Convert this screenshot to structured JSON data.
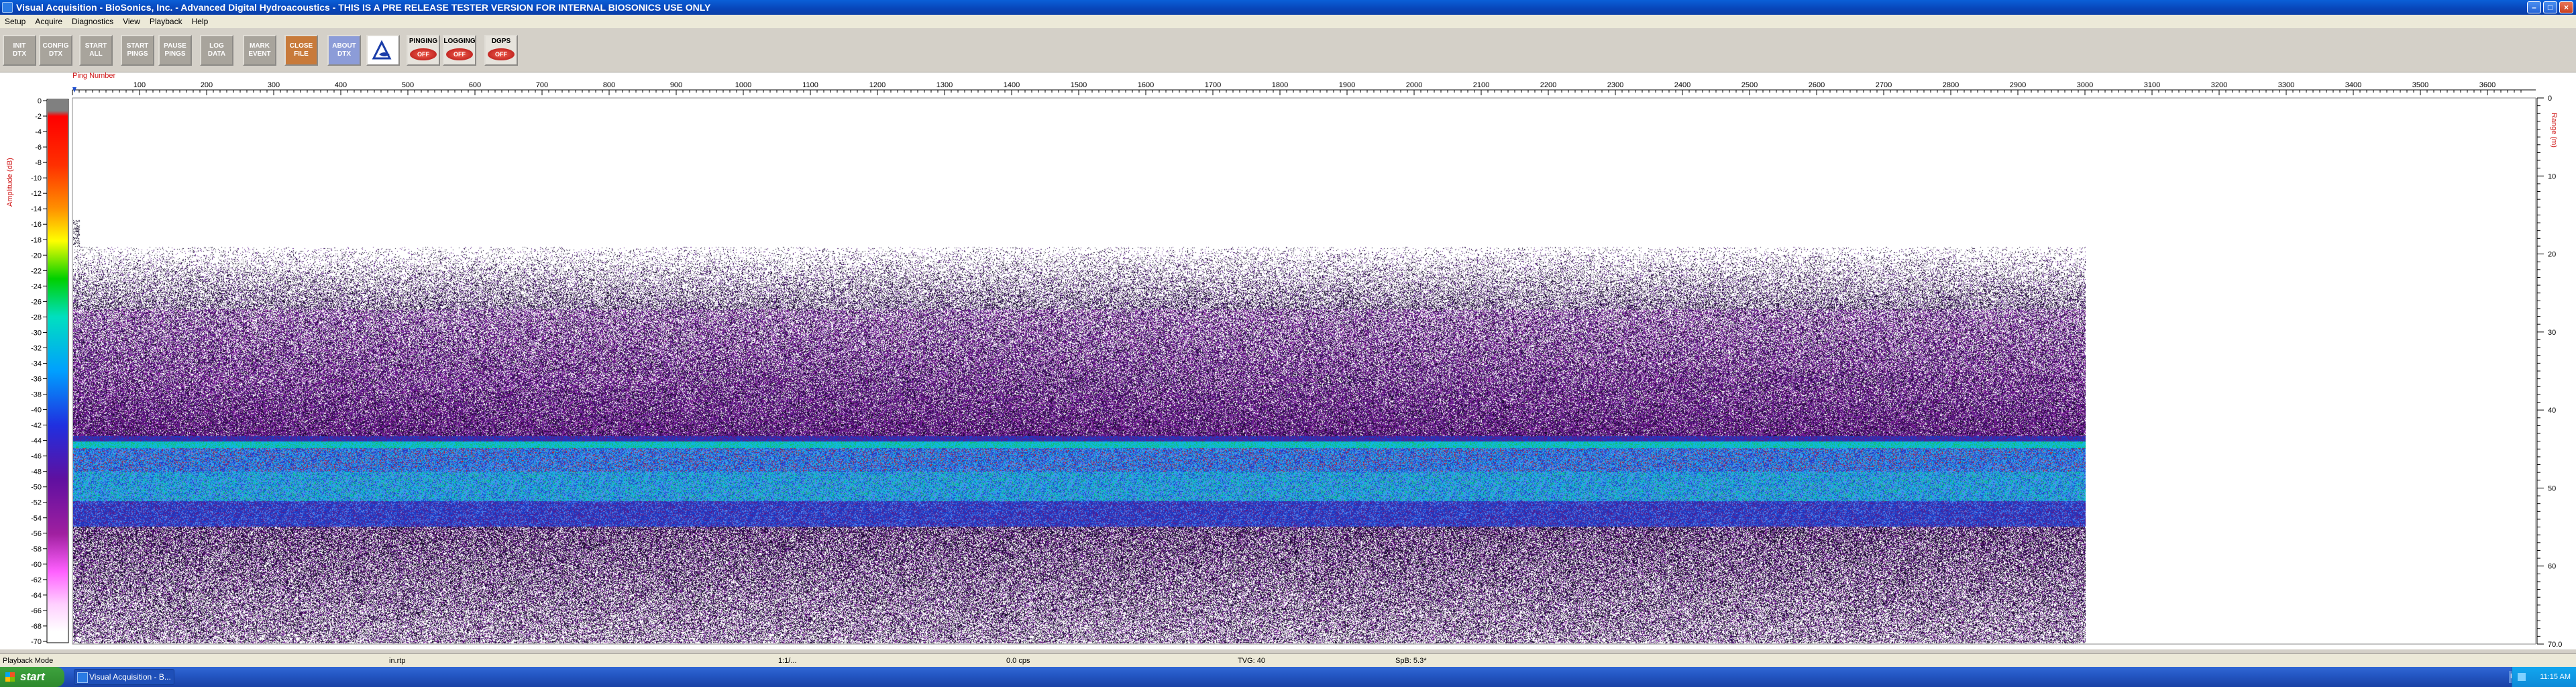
{
  "window": {
    "title": "Visual Acquisition  -  BioSonics, Inc.  -  Advanced Digital Hydroacoustics  -  THIS IS A PRE RELEASE TESTER VERSION FOR INTERNAL BIOSONICS USE ONLY"
  },
  "menu": [
    "Setup",
    "Acquire",
    "Diagnostics",
    "View",
    "Playback",
    "Help"
  ],
  "toolbar": {
    "buttons": [
      {
        "label": "INIT\nDTX",
        "style": "gray"
      },
      {
        "label": "CONFIG\nDTX",
        "style": "gray"
      },
      {
        "label": "START\nALL",
        "style": "gray"
      },
      {
        "label": "START\nPINGS",
        "style": "gray"
      },
      {
        "label": "PAUSE\nPINGS",
        "style": "gray"
      },
      {
        "label": "LOG\nDATA",
        "style": "gray"
      },
      {
        "label": "MARK\nEVENT",
        "style": "gray"
      },
      {
        "label": "CLOSE\nFILE",
        "style": "orange"
      },
      {
        "label": "ABOUT\nDTX",
        "style": "blue"
      }
    ],
    "indicators": [
      {
        "label": "PINGING",
        "state": "OFF"
      },
      {
        "label": "LOGGING",
        "state": "OFF"
      },
      {
        "label": "DGPS",
        "state": "OFF"
      }
    ]
  },
  "echogram": {
    "x_axis_title": "Ping Number",
    "x_ticks": [
      "100",
      "200",
      "300",
      "400",
      "500",
      "600",
      "700",
      "800",
      "900",
      "1000",
      "1100",
      "1200",
      "1300",
      "1400",
      "1500",
      "1600",
      "1700",
      "1800",
      "1900",
      "2000",
      "2100",
      "2200",
      "2300",
      "2400",
      "2500",
      "2600",
      "2700",
      "2800",
      "2900",
      "3000",
      "3100",
      "3200",
      "3300",
      "3400",
      "3500",
      "3600"
    ],
    "amplitude_axis_title": "Amplitude (dB)",
    "amplitude_ticks": [
      "0",
      "-2",
      "-4",
      "-6",
      "-8",
      "-10",
      "-12",
      "-14",
      "-16",
      "-18",
      "-20",
      "-22",
      "-24",
      "-26",
      "-28",
      "-30",
      "-32",
      "-34",
      "-36",
      "-38",
      "-40",
      "-42",
      "-44",
      "-46",
      "-48",
      "-50",
      "-52",
      "-54",
      "-56",
      "-58",
      "-60",
      "-62",
      "-64",
      "-66",
      "-68",
      "-70"
    ],
    "range_axis_title": "Range (m)",
    "range_ticks": [
      "0",
      "10",
      "20",
      "30",
      "40",
      "50",
      "60",
      "70.0"
    ],
    "data_pings": 3000,
    "max_range_m": 70.0,
    "noise_onset_m": 19,
    "dense_noise_m": 27,
    "bottom_band_top_m": 44,
    "bottom_band_bottom_m": 55,
    "colors": {
      "noise": "#5a1a8a",
      "bottom_cyan": "#10b8e0",
      "bottom_blue": "#1a3cc8",
      "bottom_red": "#d01818",
      "bottom_green": "#10c060"
    }
  },
  "status_bar": {
    "mode": "Playback Mode",
    "fields": [
      "in.rtp",
      "1:1/...",
      "0.0 cps",
      "TVG: 40",
      "SpB: 5.3*"
    ]
  },
  "taskbar": {
    "start": "start",
    "app": "Visual Acquisition - B...",
    "lang": "EN",
    "clock": "11:15 AM"
  }
}
